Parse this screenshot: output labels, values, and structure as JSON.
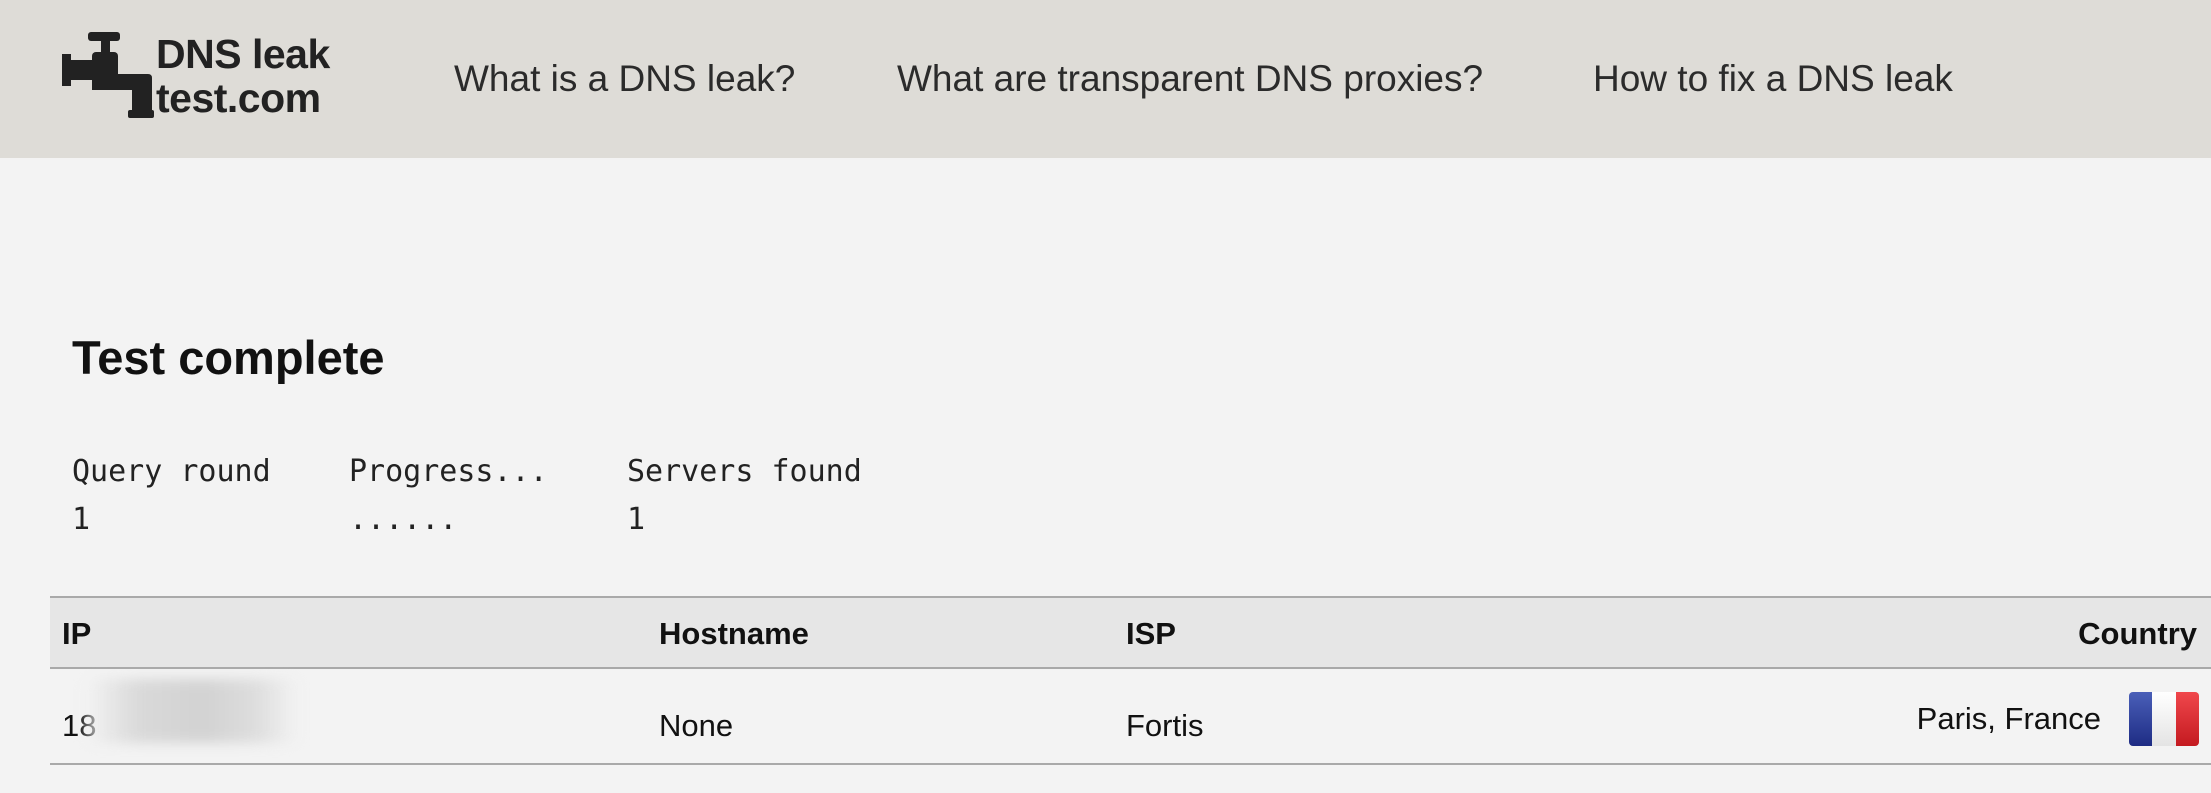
{
  "header": {
    "logo": {
      "line1": "DNS leak",
      "line2": "test.com"
    },
    "nav": [
      {
        "label": "What is a DNS leak?"
      },
      {
        "label": "What are transparent DNS proxies?"
      },
      {
        "label": "How to fix a DNS leak"
      }
    ]
  },
  "main": {
    "title": "Test complete",
    "stats": {
      "query_round_label": "Query round",
      "query_round_value": "1",
      "progress_label": "Progress...",
      "progress_value": "......",
      "servers_found_label": "Servers found",
      "servers_found_value": "1"
    },
    "table": {
      "columns": [
        "IP",
        "Hostname",
        "ISP",
        "Country"
      ],
      "rows": [
        {
          "ip": "18",
          "hostname": "None",
          "isp": "Fortis",
          "country": "Paris, France",
          "flag_icon": "france-flag-icon"
        }
      ]
    }
  },
  "colors": {
    "header_bg": "#dedcd7",
    "page_bg": "#f3f3f3",
    "table_header_bg": "#e6e6e6"
  }
}
